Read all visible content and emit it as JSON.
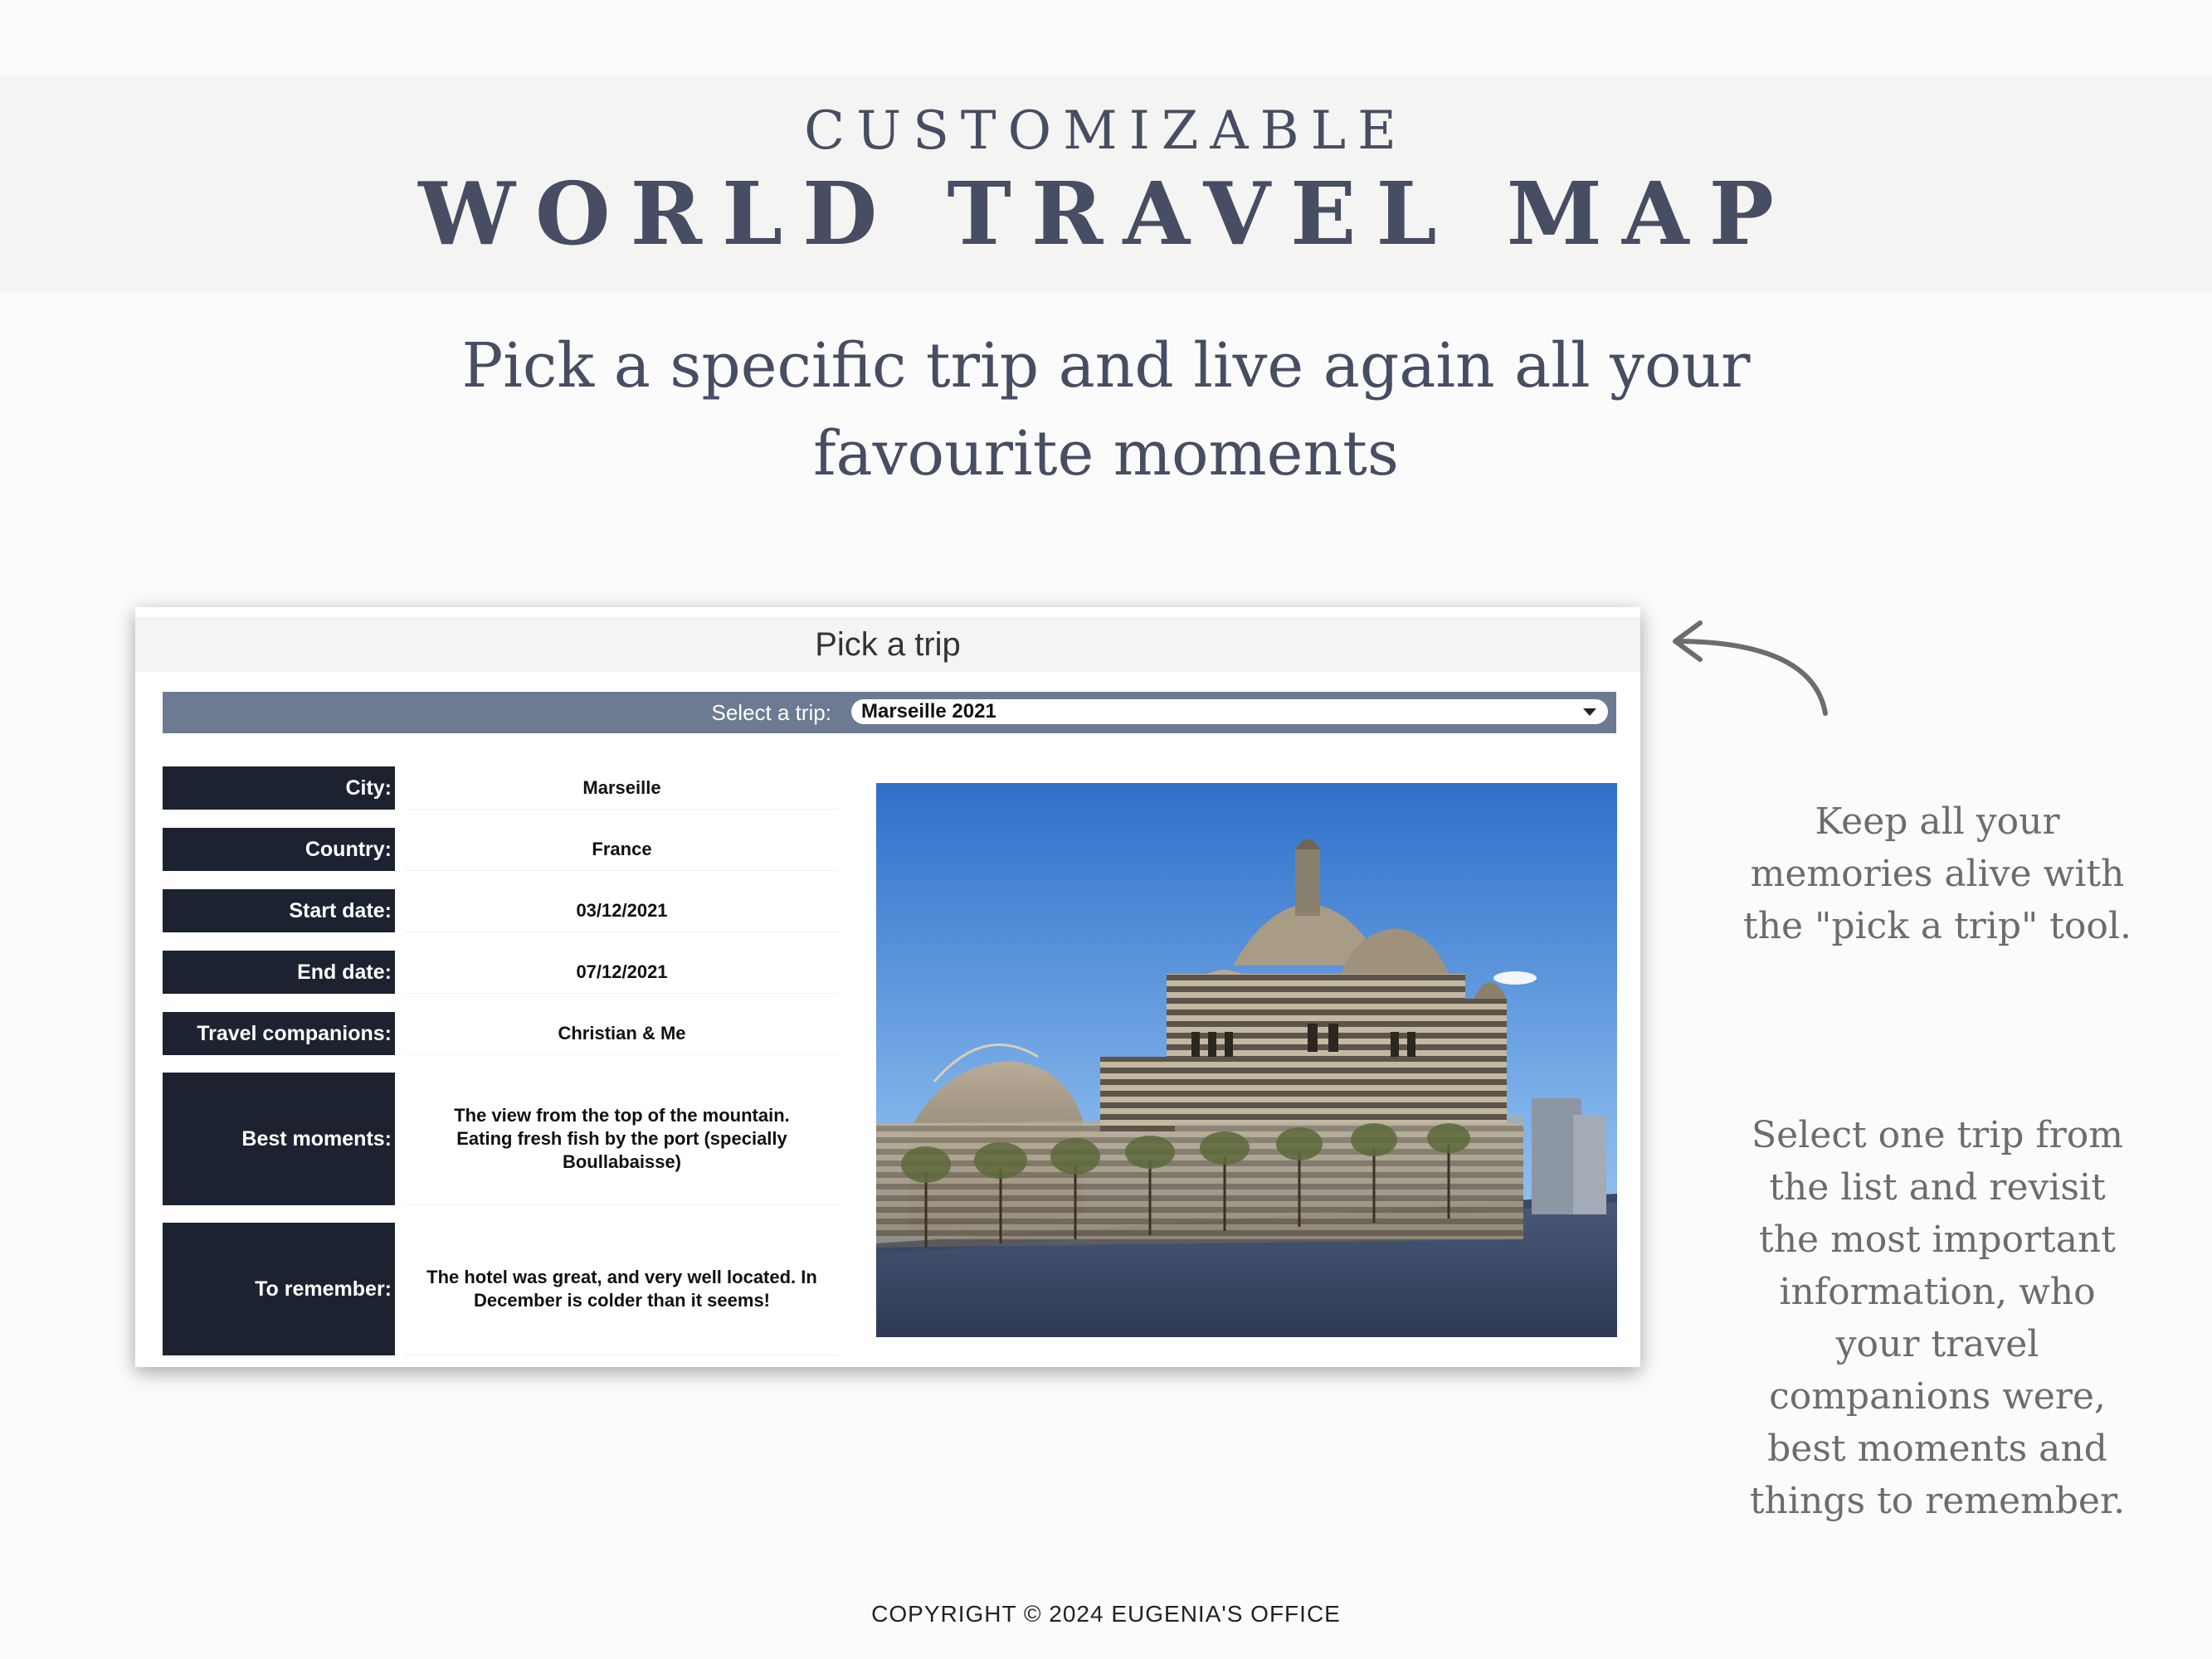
{
  "header": {
    "eyebrow": "CUSTOMIZABLE",
    "title": "WORLD TRAVEL MAP"
  },
  "subtitle": "Pick a specific trip and live again all your favourite moments",
  "mockup": {
    "title": "Pick a trip",
    "select_label": "Select a trip:",
    "select_value": "Marseille 2021",
    "fields": [
      {
        "label": "City:",
        "value": "Marseille"
      },
      {
        "label": "Country:",
        "value": "France"
      },
      {
        "label": "Start date:",
        "value": "03/12/2021"
      },
      {
        "label": "End date:",
        "value": "07/12/2021"
      },
      {
        "label": "Travel companions:",
        "value": "Christian & Me"
      },
      {
        "label": "Best moments:",
        "value": "The view from the top of the mountain. Eating fresh fish by the port (specially Boullabaisse)"
      },
      {
        "label": "To remember:",
        "value": "The hotel was great, and very well located. In December is colder than it seems!"
      }
    ]
  },
  "side_text": {
    "paragraph1": "Keep all your\nmemories alive with\nthe \"pick a trip\" tool.",
    "paragraph2": "Select one trip from\nthe list and revisit\nthe most important\ninformation, who\nyour travel\ncompanions were,\nbest moments and\nthings to remember."
  },
  "footer": {
    "copyright": "COPYRIGHT © 2024 EUGENIA'S OFFICE"
  },
  "colors": {
    "heading": "#474d62",
    "label_bg": "#1c2230",
    "select_bar": "#6c7a92",
    "band_bg": "#f4f4f2",
    "side_text": "#6c6c6c"
  },
  "icons": {
    "arrow": "curved-arrow-icon",
    "caret": "chevron-down-icon"
  }
}
